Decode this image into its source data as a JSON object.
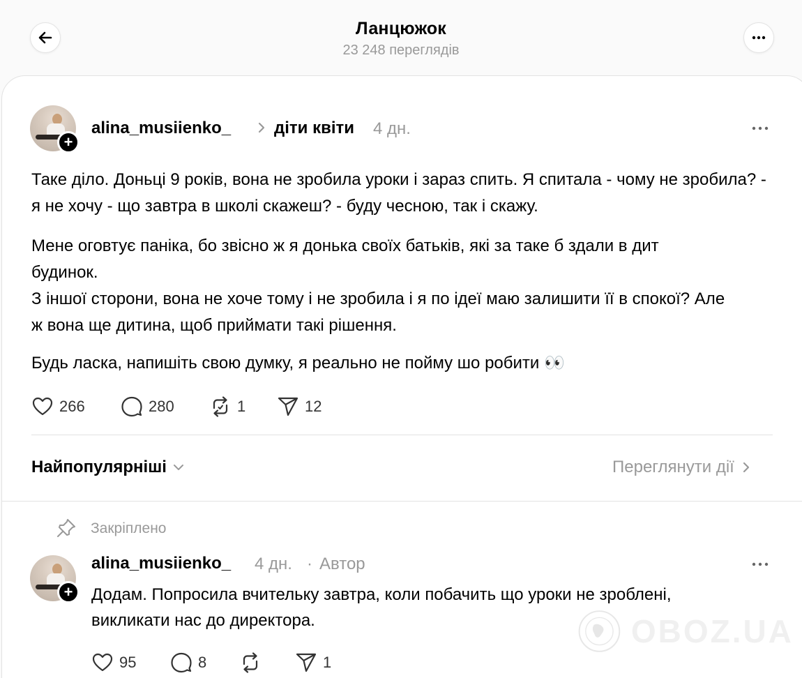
{
  "header": {
    "title": "Ланцюжок",
    "views": "23 248 переглядів"
  },
  "post": {
    "username": "alina_musiienko_",
    "topic": "діти квіти",
    "time": "4 дн.",
    "paragraphs": [
      "Таке діло. Доньці 9 років, вона не зробила уроки і зараз спить. Я спитала - чому не зробила? - я не хочу - що завтра в школі скажеш? - буду чесною, так і скажу.",
      "Мене оговтує паніка, бо звісно ж я донька своїх батьків, які за таке б здали в дит будинок.",
      "З іншої сторони, вона не хоче тому і не зробила і я по ідеї маю залишити її в спокої? Але ж вона ще дитина, щоб приймати такі рішення.",
      "Будь ласка, напишіть свою думку, я реально не пойму шо робити 👀"
    ],
    "likes": "266",
    "comments": "280",
    "reposts": "1",
    "shares": "12"
  },
  "sort": {
    "label": "Найпопулярніші",
    "activity_link": "Переглянути дії"
  },
  "reply": {
    "pinned_label": "Закріплено",
    "username": "alina_musiienko_",
    "time": "4 дн.",
    "separator": "·",
    "author_badge": "Автор",
    "text_lines": [
      "Додам. Попросила вчительку завтра, коли побачить що уроки не зроблені,",
      "викликати нас до директора."
    ],
    "likes": "95",
    "comments": "8",
    "shares": "1"
  },
  "watermark": {
    "text": "OBOZ.UA"
  },
  "colors": {
    "background": "#fafafa",
    "card": "#ffffff",
    "muted_text": "#999999",
    "divider": "#e2e2e2"
  },
  "icons": [
    "back-arrow-icon",
    "more-icon",
    "chevron-right-icon",
    "heart-icon",
    "comment-icon",
    "repost-icon",
    "share-icon",
    "chevron-down-icon",
    "pin-icon",
    "globe-icon"
  ]
}
